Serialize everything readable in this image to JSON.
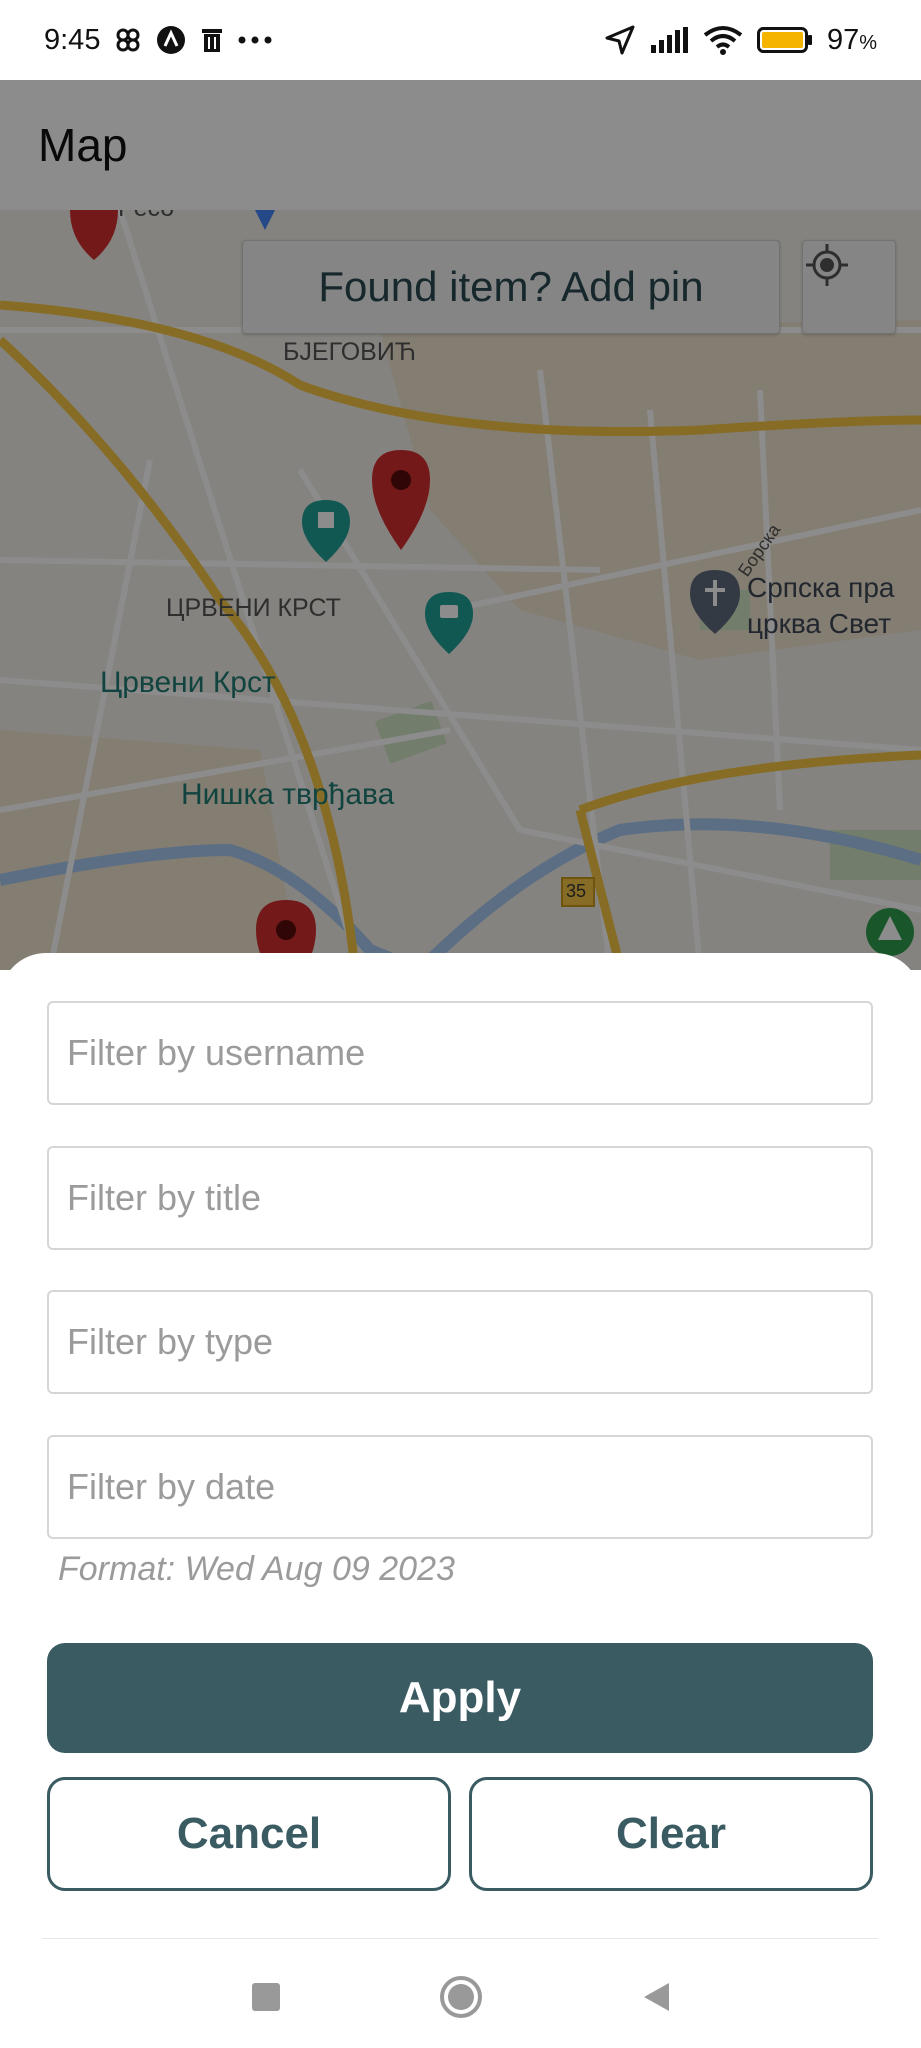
{
  "status_bar": {
    "time": "9:45",
    "battery_percent": "97",
    "battery_unit": "%",
    "icons": [
      "pinwheel-icon",
      "a-circle-icon",
      "trash-icon",
      "more-icon",
      "location-arrow-icon",
      "signal-icon",
      "wifi-icon",
      "battery-icon"
    ]
  },
  "app_bar": {
    "title": "Map"
  },
  "map": {
    "add_pin_label": "Found item? Add pin",
    "labels": {
      "top_partial": "Ресо",
      "bjegovic": "БЈЕГОВИЋ",
      "crveni_krst_district": "ЦРВЕНИ КРСТ",
      "crveni_krst_poi": "Црвени Крст",
      "fortress_poi": "Нишка тврђава",
      "church_line1": "Српска пра",
      "church_line2": "црква Свет",
      "borska": "Борска",
      "road_35": "35"
    },
    "colors": {
      "pin": "#d32f2f",
      "poi": "#1f7c74",
      "road": "#f4c542"
    }
  },
  "filters": {
    "username_placeholder": "Filter by username",
    "title_placeholder": "Filter by title",
    "type_placeholder": "Filter by type",
    "date_placeholder": "Filter by date",
    "date_hint": "Format: Wed Aug 09 2023"
  },
  "actions": {
    "apply": "Apply",
    "cancel": "Cancel",
    "clear": "Clear"
  },
  "colors": {
    "accent": "#3b5b63"
  }
}
